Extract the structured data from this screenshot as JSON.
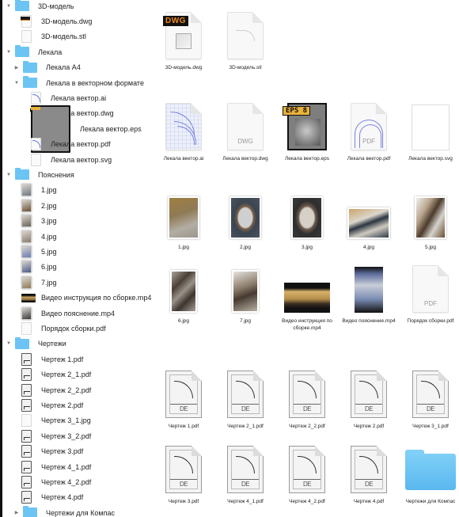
{
  "tree": [
    {
      "level": 0,
      "type": "folder",
      "expanded": true,
      "label": "3D-модель"
    },
    {
      "level": 1,
      "type": "dwg",
      "label": "3D-модель.dwg"
    },
    {
      "level": 1,
      "type": "stl",
      "label": "3D-модель.stl"
    },
    {
      "level": 0,
      "type": "folder",
      "expanded": true,
      "label": "Лекала"
    },
    {
      "level": 1,
      "type": "folder",
      "expanded": false,
      "label": "Лекала А4"
    },
    {
      "level": 1,
      "type": "folder",
      "expanded": true,
      "label": "Лекала в векторном формате"
    },
    {
      "level": 2,
      "type": "ai",
      "label": "Лекала вектор.ai"
    },
    {
      "level": 2,
      "type": "dwg",
      "label": "Лекала вектор.dwg"
    },
    {
      "level": 2,
      "type": "eps",
      "label": "Лекала вектор.eps"
    },
    {
      "level": 2,
      "type": "vpdf",
      "label": "Лекала вектор.pdf"
    },
    {
      "level": 2,
      "type": "svg",
      "label": "Лекала вектор.svg"
    },
    {
      "level": 0,
      "type": "folder",
      "expanded": true,
      "label": "Пояснения"
    },
    {
      "level": 1,
      "type": "photo",
      "label": "1.jpg"
    },
    {
      "level": 1,
      "type": "photo",
      "label": "2.jpg"
    },
    {
      "level": 1,
      "type": "photo",
      "label": "3.jpg"
    },
    {
      "level": 1,
      "type": "photo",
      "label": "4.jpg"
    },
    {
      "level": 1,
      "type": "photo",
      "label": "5.jpg"
    },
    {
      "level": 1,
      "type": "photo",
      "label": "6.jpg"
    },
    {
      "level": 1,
      "type": "photo",
      "label": "7.jpg"
    },
    {
      "level": 1,
      "type": "video",
      "label": "Видео инструкция по сборке.mp4"
    },
    {
      "level": 1,
      "type": "photo",
      "label": "Видео пояснение.mp4"
    },
    {
      "level": 1,
      "type": "pdf",
      "label": "Порядок сборки.pdf"
    },
    {
      "level": 0,
      "type": "folder",
      "expanded": true,
      "label": "Чертежи"
    },
    {
      "level": 1,
      "type": "draw",
      "label": "Чертеж 1.pdf"
    },
    {
      "level": 1,
      "type": "draw",
      "label": "Чертеж 2_1.pdf"
    },
    {
      "level": 1,
      "type": "draw",
      "label": "Чертеж 2_2.pdf"
    },
    {
      "level": 1,
      "type": "draw",
      "label": "Чертеж 2.pdf"
    },
    {
      "level": 1,
      "type": "jpgdraw",
      "label": "Чертеж 3_1.jpg"
    },
    {
      "level": 1,
      "type": "draw",
      "label": "Чертеж 3_2.pdf"
    },
    {
      "level": 1,
      "type": "draw",
      "label": "Чертеж 3.pdf"
    },
    {
      "level": 1,
      "type": "draw",
      "label": "Чертеж 4_1.pdf"
    },
    {
      "level": 1,
      "type": "draw",
      "label": "Чертеж 4_2.pdf"
    },
    {
      "level": 1,
      "type": "draw",
      "label": "Чертеж 4.pdf"
    },
    {
      "level": 1,
      "type": "folder",
      "expanded": false,
      "label": "Чертежи для Компас"
    }
  ],
  "grid": {
    "row1": [
      {
        "kind": "dwg3d",
        "label": "3D-модель.dwg",
        "badge": "DWG"
      },
      {
        "kind": "stl",
        "label": "3D-модель.stl"
      }
    ],
    "row2": [
      {
        "kind": "ai",
        "label": "Лекала вектор.ai"
      },
      {
        "kind": "dwgplain",
        "label": "Лекала вектор.dwg",
        "ext": "DWG"
      },
      {
        "kind": "eps",
        "label": "Лекала вектор.eps",
        "badge": "EPS 8"
      },
      {
        "kind": "vpdf",
        "label": "Лекала вектор.pdf",
        "ext": "PDF"
      },
      {
        "kind": "svg",
        "label": "Лекала вектор.svg"
      }
    ],
    "row3": [
      {
        "kind": "ph-1",
        "label": "1.jpg"
      },
      {
        "kind": "ph-2",
        "label": "2.jpg"
      },
      {
        "kind": "ph-3",
        "label": "3.jpg"
      },
      {
        "kind": "ph-4",
        "label": "4.jpg"
      },
      {
        "kind": "ph-5",
        "label": "5.jpg"
      }
    ],
    "row4": [
      {
        "kind": "ph-6",
        "label": "6.jpg"
      },
      {
        "kind": "ph-7",
        "label": "7.jpg"
      },
      {
        "kind": "vid-1",
        "label": "Видео инструкция по сборке.mp4"
      },
      {
        "kind": "vid-2",
        "label": "Видео пояснение.mp4"
      },
      {
        "kind": "pdf",
        "label": "Порядок сборки.pdf",
        "ext": "PDF"
      }
    ],
    "row5": [
      {
        "kind": "drawing",
        "label": "Чертеж 1.pdf",
        "stamp": "DE"
      },
      {
        "kind": "drawing",
        "label": "Чертеж 2_1.pdf",
        "stamp": "DE"
      },
      {
        "kind": "drawing",
        "label": "Чертеж 2_2.pdf",
        "stamp": "DE"
      },
      {
        "kind": "drawing",
        "label": "Чертеж 2.pdf",
        "stamp": "DE"
      },
      {
        "kind": "drawing",
        "label": "Чертеж 3_1.pdf",
        "stamp": "DE"
      }
    ],
    "row6": [
      {
        "kind": "drawing",
        "label": "Чертеж 3.pdf",
        "stamp": "DE"
      },
      {
        "kind": "drawing",
        "label": "Чертеж 4_1.pdf",
        "stamp": "DE"
      },
      {
        "kind": "drawing",
        "label": "Чертеж 4_2.pdf",
        "stamp": "DE"
      },
      {
        "kind": "drawing",
        "label": "Чертеж 4.pdf",
        "stamp": "DE"
      },
      {
        "kind": "folder",
        "label": "Чертежи для Компас"
      }
    ]
  },
  "colors": {
    "folder": "#6cc4f4",
    "dwg_badge_text": "#f08a1c",
    "eps_badge": "#e9b23b",
    "vector_line": "#7a82e2"
  }
}
